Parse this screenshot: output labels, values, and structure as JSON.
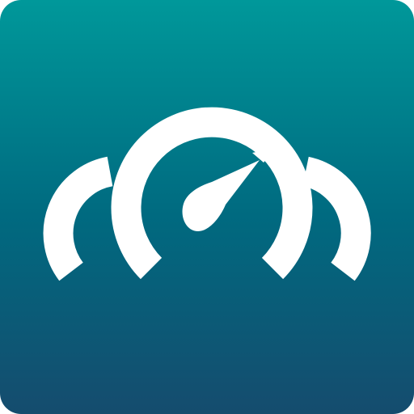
{
  "app_icon": {
    "icon_name": "speedometer-gauge-icon",
    "colors": {
      "background_top": "#00989A",
      "background_mid": "#006A80",
      "background_bottom": "#154C6E",
      "glyph": "#FFFFFF"
    }
  }
}
